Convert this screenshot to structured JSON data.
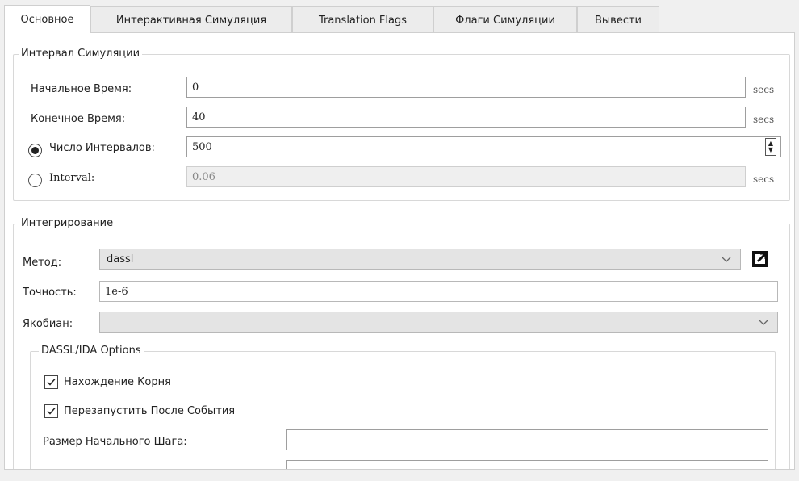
{
  "tabs": [
    {
      "label": "Основное"
    },
    {
      "label": "Интерактивная Симуляция"
    },
    {
      "label": "Translation Flags"
    },
    {
      "label": "Флаги Симуляции"
    },
    {
      "label": "Вывести"
    }
  ],
  "interval_group": {
    "title": "Интервал Симуляции",
    "start_time": {
      "label": "Начальное Время:",
      "value": "0",
      "unit": "secs"
    },
    "stop_time": {
      "label": "Конечное Время:",
      "value": "40",
      "unit": "secs"
    },
    "num_intervals": {
      "label": "Число Интервалов:",
      "value": "500",
      "selected": true
    },
    "interval": {
      "label": "Interval:",
      "value": "0.06",
      "unit": "secs",
      "selected": false
    }
  },
  "integration_group": {
    "title": "Интегрирование",
    "method": {
      "label": "Метод:",
      "value": "dassl"
    },
    "tolerance": {
      "label": "Точность:",
      "value": "1e-6"
    },
    "jacobian": {
      "label": "Якобиан:",
      "value": ""
    },
    "dassl_options": {
      "title": "DASSL/IDA Options",
      "root_finding": {
        "label": "Нахождение Корня",
        "checked": true
      },
      "restart_after_event": {
        "label": "Перезапустить После События",
        "checked": true
      },
      "initial_step_size": {
        "label": "Размер Начального Шага:",
        "value": ""
      },
      "max_step_size": {
        "value": ""
      }
    }
  },
  "icons": [
    "radio-button",
    "spinbox-arrows",
    "chevron-down-icon",
    "external-link-icon",
    "checkmark-icon"
  ]
}
